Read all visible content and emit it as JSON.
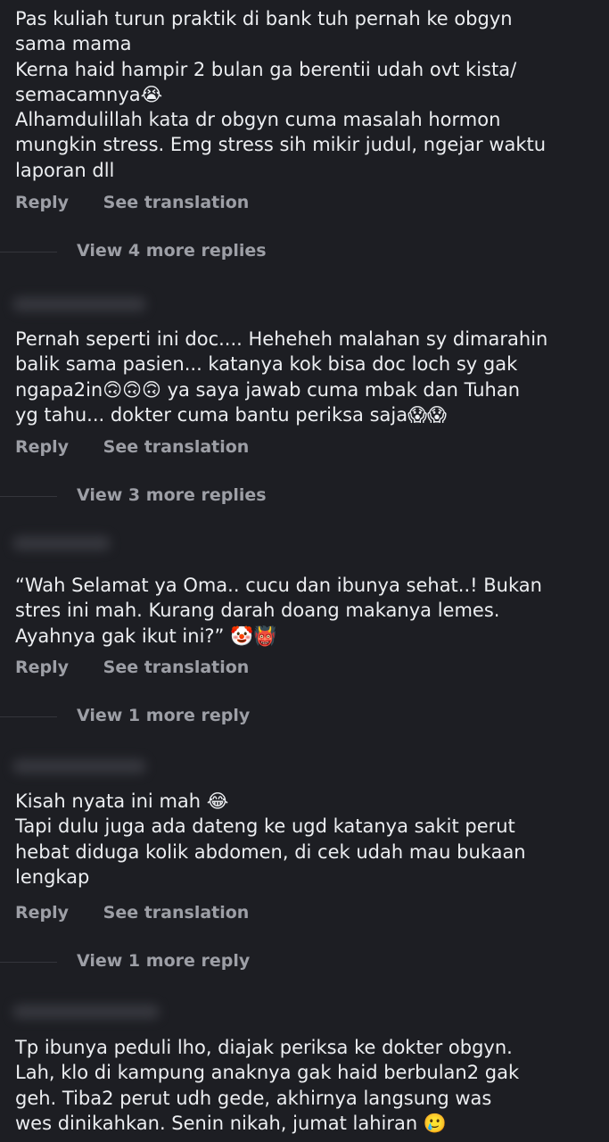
{
  "comments": [
    {
      "text": "Pas kuliah turun praktik di bank tuh pernah ke obgyn\nsama mama\nKerna haid hampir 2 bulan ga berentii udah ovt kista/\nsemacamnya😭\nAlhamdulillah kata dr obgyn cuma masalah hormon\nmungkin stress. Emg stress sih mikir judul, ngejar waktu\nlaporan dll",
      "reply_label": "Reply",
      "translate_label": "See translation",
      "more_replies_label": "View 4 more replies"
    },
    {
      "text": "Pernah seperti ini doc.... Heheheh malahan sy dimarahin\nbalik sama pasien... katanya kok bisa doc loch sy gak\nngapa2in🙃🙃🙃 ya saya jawab cuma mbak dan Tuhan\nyg tahu... dokter cuma bantu periksa saja😱😱",
      "reply_label": "Reply",
      "translate_label": "See translation",
      "more_replies_label": "View 3 more replies"
    },
    {
      "text": "“Wah Selamat ya Oma.. cucu dan ibunya sehat..! Bukan\nstres ini mah. Kurang darah doang makanya lemes.\nAyahnya gak ikut ini?” 🤡👹",
      "reply_label": "Reply",
      "translate_label": "See translation",
      "more_replies_label": "View 1 more reply"
    },
    {
      "text": "Kisah nyata ini mah 😂\nTapi dulu juga ada dateng ke ugd katanya sakit perut\nhebat diduga kolik abdomen, di cek udah mau bukaan\nlengkap",
      "reply_label": "Reply",
      "translate_label": "See translation",
      "more_replies_label": "View 1 more reply"
    },
    {
      "text": "Tp ibunya peduli lho, diajak periksa ke dokter obgyn.\nLah, klo di kampung anaknya gak haid berbulan2 gak\ngeh. Tiba2 perut udh gede, akhirnya langsung was\nwes dinikahkan. Senin nikah, jumat lahiran 🥲"
    }
  ]
}
